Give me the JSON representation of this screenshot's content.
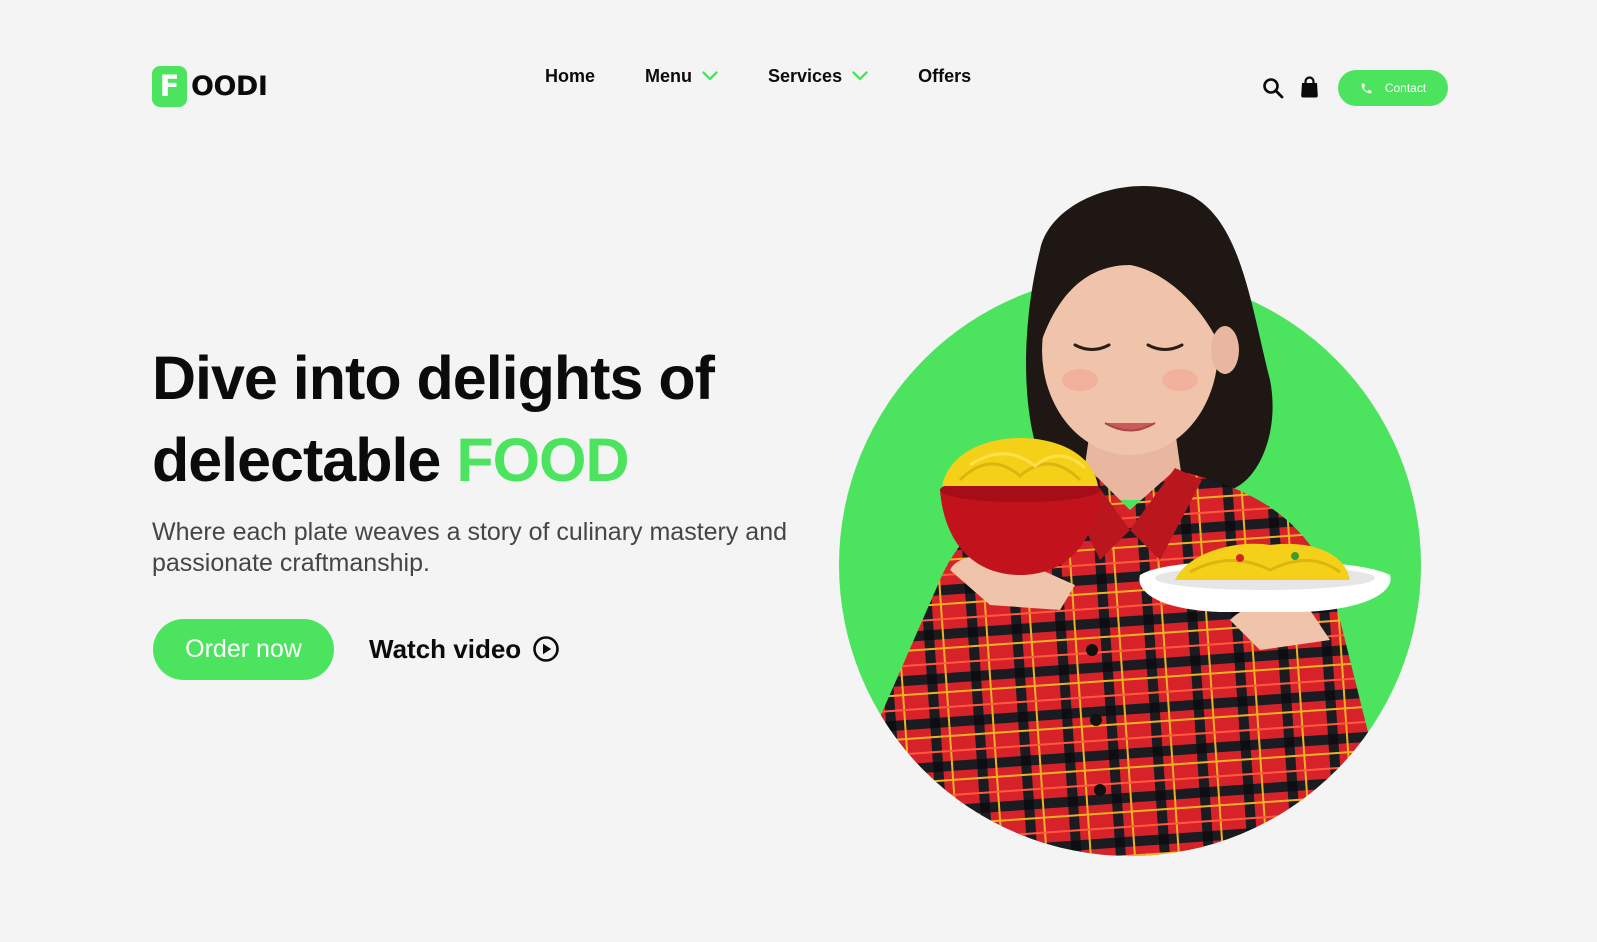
{
  "header": {
    "logo": {
      "letter": "F",
      "text": "OODI"
    },
    "nav": [
      {
        "label": "Home",
        "dropdown": false
      },
      {
        "label": "Menu",
        "dropdown": true
      },
      {
        "label": "Services",
        "dropdown": true
      },
      {
        "label": "Offers",
        "dropdown": false
      }
    ],
    "icons": [
      "search-icon",
      "shopping-bag-icon",
      "phone-icon"
    ],
    "contact_label": "Contact"
  },
  "hero": {
    "title_part1": "Dive into delights of",
    "title_part2": "delectable",
    "title_accent": "FOOD",
    "subtitle": "Where each plate weaves a story of culinary mastery and passionate craftmanship.",
    "order_label": "Order now",
    "watch_label": "Watch video"
  },
  "colors": {
    "accent": "#4ce45f",
    "background": "#f4f4f4",
    "text": "#0b0b0b",
    "subtitle": "#454545"
  }
}
